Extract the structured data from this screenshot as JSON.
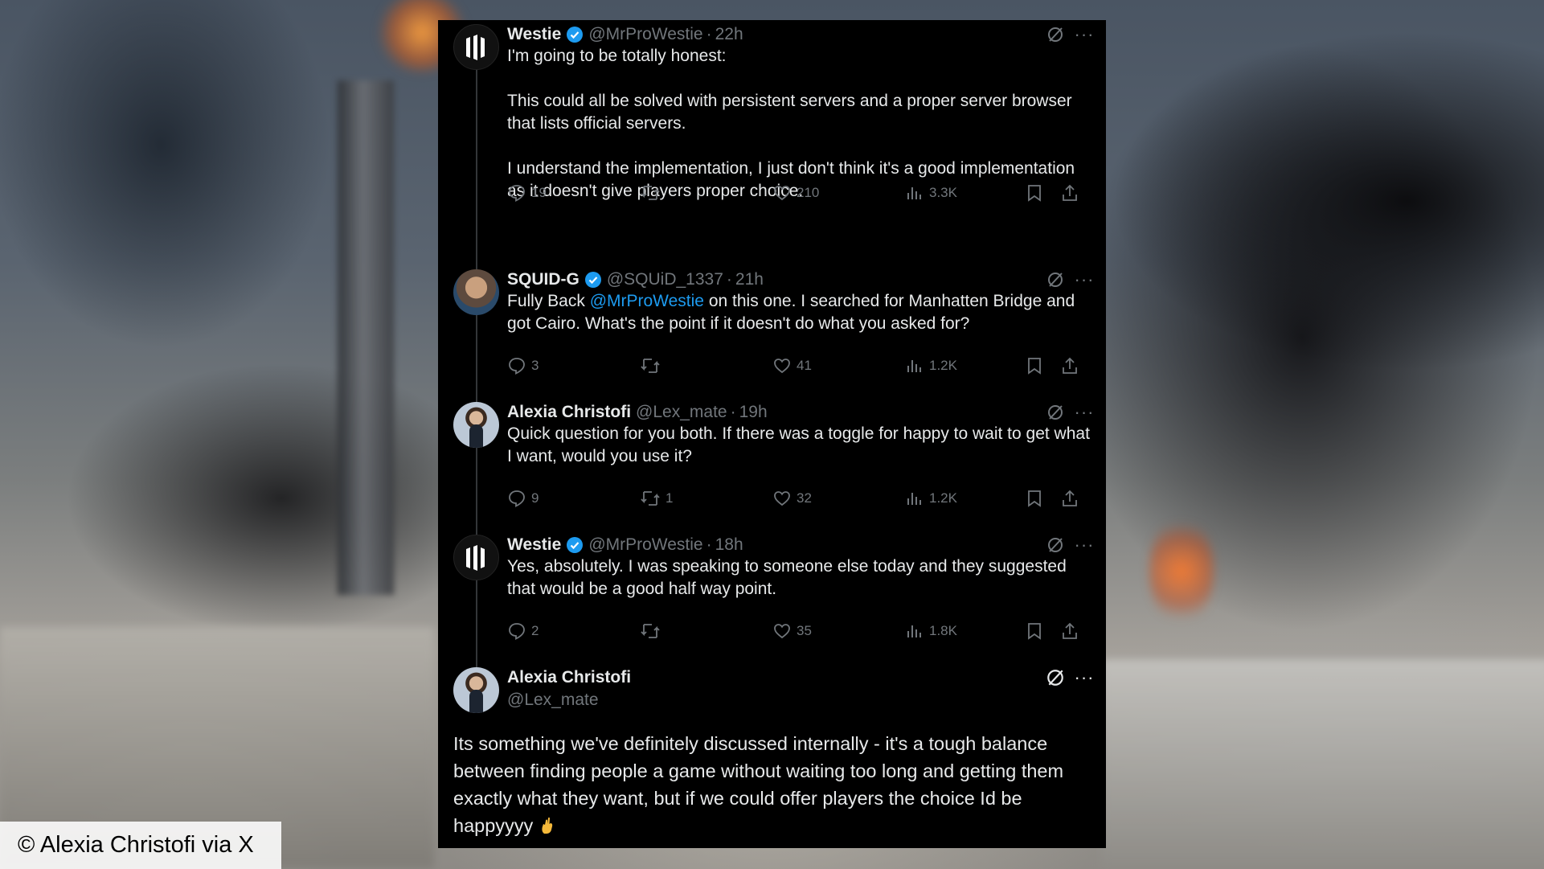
{
  "theme": {
    "background": "#000000",
    "text": "#e7e9ea",
    "muted": "#71767b",
    "accent": "#1d9bf0"
  },
  "tweets": [
    {
      "name": "Westie",
      "verified": true,
      "handle": "@MrProWestie",
      "time": "22h",
      "avatar": "westie-logo",
      "paragraphs": [
        "I'm going to be totally honest:",
        "This could all be solved with persistent servers and a proper server browser that lists official servers.",
        "I understand the implementation, I just don't think it's a good implementation as it doesn't give players proper choice."
      ],
      "stats": {
        "replies": "19",
        "reposts": "",
        "likes": "210",
        "views": "3.3K"
      }
    },
    {
      "name": "SQUID-G",
      "verified": true,
      "handle": "@SQUiD_1337",
      "time": "21h",
      "avatar": "squid-photo",
      "text_before": "Fully Back ",
      "mention": "@MrProWestie",
      "text_after": " on this one. I searched for Manhatten Bridge and got Cairo. What's the point if it doesn't do what you asked for?",
      "stats": {
        "replies": "3",
        "reposts": "",
        "likes": "41",
        "views": "1.2K"
      }
    },
    {
      "name": "Alexia Christofi",
      "verified": false,
      "handle": "@Lex_mate",
      "time": "19h",
      "avatar": "alexia-photo",
      "text": "Quick question for you both. If there was a toggle for happy to wait to get what I want, would you use it?",
      "stats": {
        "replies": "9",
        "reposts": "1",
        "likes": "32",
        "views": "1.2K"
      }
    },
    {
      "name": "Westie",
      "verified": true,
      "handle": "@MrProWestie",
      "time": "18h",
      "avatar": "westie-logo",
      "text": "Yes, absolutely. I was speaking to someone else today and they suggested that would be a good half way point.",
      "stats": {
        "replies": "2",
        "reposts": "",
        "likes": "35",
        "views": "1.8K"
      }
    }
  ],
  "main_tweet": {
    "name": "Alexia Christofi",
    "handle": "@Lex_mate",
    "avatar": "alexia-photo",
    "text": "Its something we've definitely discussed internally - it's a tough balance between finding people a game without waiting too long and getting them exactly what they want, but if we could offer players the choice Id be happyyyy",
    "emoji": "crossed-fingers-emoji"
  },
  "caption": "© Alexia Christofi via X"
}
